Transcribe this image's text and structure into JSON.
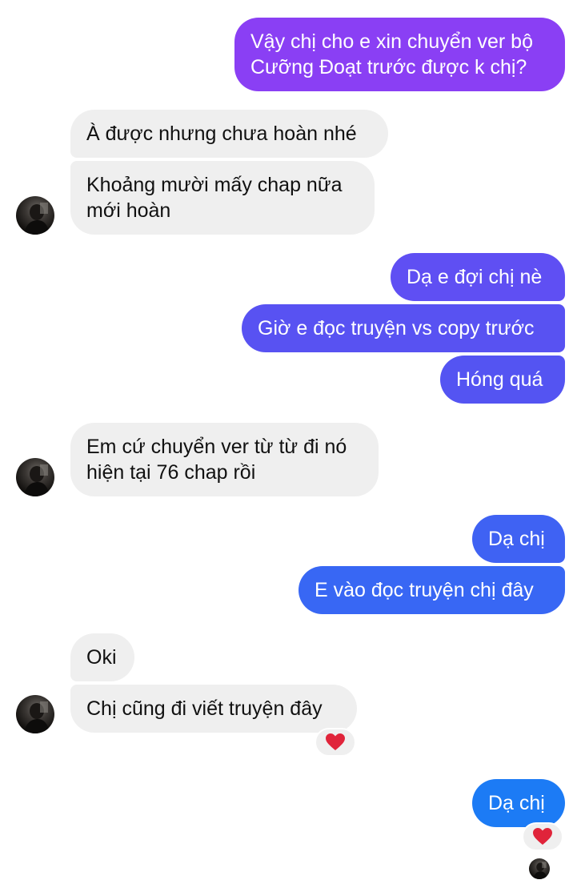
{
  "colors": {
    "incoming_bg": "#efefef",
    "outgoing_gradient_top": "#8a3ff4",
    "outgoing_gradient_mid": "#5a52f2",
    "outgoing_gradient_bottom": "#1c7bf5",
    "reaction_heart": "#e0243a"
  },
  "messages": [
    {
      "sender": "me",
      "text": "Vậy chị cho e xin chuyển ver bộ\nCưỡng Đoạt trước được k chị?"
    },
    {
      "sender": "other",
      "text": "À được nhưng chưa hoàn nhé"
    },
    {
      "sender": "other",
      "text": "Khoảng mười mấy chap nữa\nmới hoàn"
    },
    {
      "sender": "me",
      "text": "Dạ e đợi chị nè"
    },
    {
      "sender": "me",
      "text": "Giờ e đọc truyện vs copy trước"
    },
    {
      "sender": "me",
      "text": "Hóng quá"
    },
    {
      "sender": "other",
      "text": "Em cứ chuyển ver từ từ đi nó\nhiện tại 76 chap rồi"
    },
    {
      "sender": "me",
      "text": "Dạ chị"
    },
    {
      "sender": "me",
      "text": "E vào đọc truyện chị đây"
    },
    {
      "sender": "other",
      "text": "Oki"
    },
    {
      "sender": "other",
      "text": "Chị cũng đi viết truyện đây",
      "reaction": "heart-icon"
    },
    {
      "sender": "me",
      "text": "Dạ chị",
      "reaction": "heart-icon"
    }
  ],
  "read_receipt": {
    "icon": "avatar-icon"
  }
}
